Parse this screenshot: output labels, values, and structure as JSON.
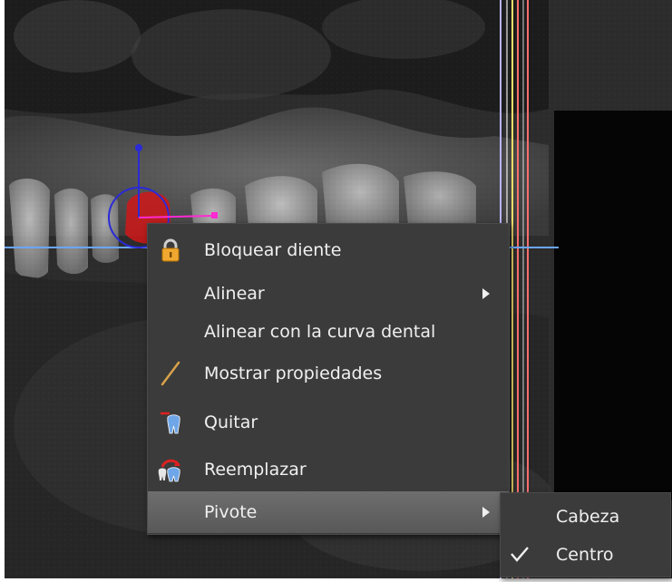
{
  "context_menu": {
    "items": [
      {
        "label": "Bloquear diente",
        "icon": "lock-icon"
      },
      {
        "label": "Alinear",
        "submenu": true
      },
      {
        "label": "Alinear con la curva dental"
      },
      {
        "label": "Mostrar propiedades",
        "icon": "pencil-icon"
      },
      {
        "label": "Quitar",
        "icon": "remove-tooth-icon"
      },
      {
        "label": "Reemplazar",
        "icon": "replace-tooth-icon"
      },
      {
        "label": "Pivote",
        "submenu": true,
        "highlighted": true
      }
    ]
  },
  "pivot_submenu": {
    "items": [
      {
        "label": "Cabeza",
        "checked": false
      },
      {
        "label": "Centro",
        "checked": true
      }
    ]
  },
  "colors": {
    "menu_bg": "#3b3b3b",
    "menu_highlight": "#646464",
    "crosshair_blue": "#6aa6ff",
    "line_purple": "#b9b3ff",
    "line_yellow": "#f4dc6a",
    "line_red": "#ff6e6e",
    "implant_red": "#d01818",
    "gizmo_blue": "#2a2ad8",
    "gizmo_magenta": "#ff2ad2"
  }
}
